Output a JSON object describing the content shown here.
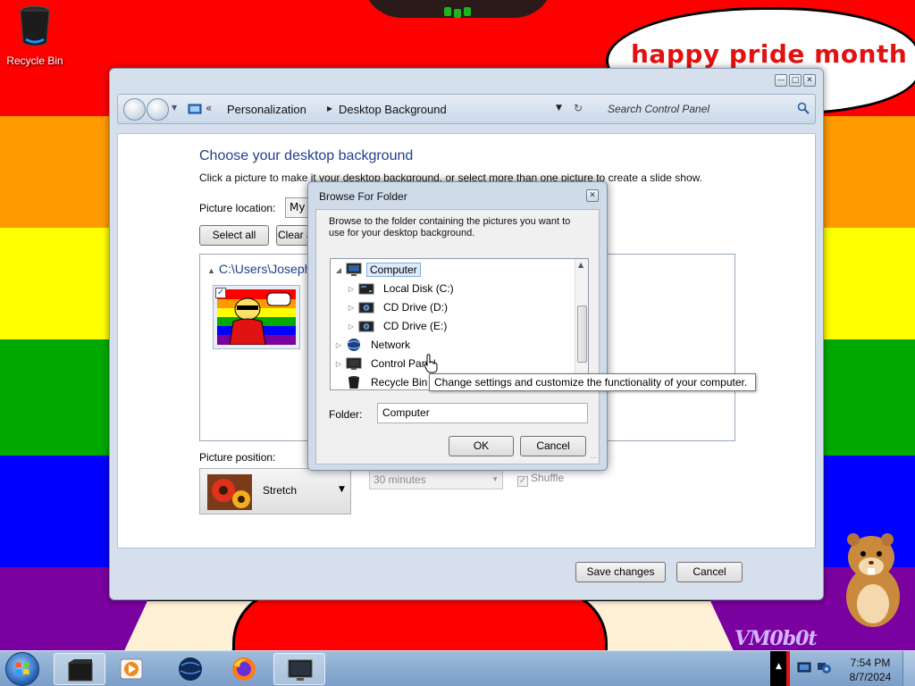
{
  "desktop": {
    "banner_text": "happy pride month",
    "watermark": "VM0b0t",
    "icons": [
      {
        "label": "Recycle Bin",
        "icon": "recycle-bin-icon"
      }
    ],
    "stripe_colors": [
      "#ff0000",
      "#ff9a00",
      "#ffff00",
      "#00a800",
      "#0000ff",
      "#7a00a0"
    ]
  },
  "window": {
    "breadcrumb": [
      "Personalization",
      "Desktop Background"
    ],
    "search_placeholder": "Search Control Panel",
    "heading": "Choose your desktop background",
    "description": "Click a picture to make it your desktop background, or select more than one picture to create a slide show.",
    "picture_location_label": "Picture location:",
    "picture_location_value": "My Pictures",
    "select_all_label": "Select all",
    "clear_all_label": "Clear all",
    "group_header": "C:\\Users\\Joseph\\Pictures",
    "picture_position_label": "Picture position:",
    "picture_position_value": "Stretch",
    "interval_value": "30 minutes",
    "shuffle_label": "Shuffle",
    "save_label": "Save changes",
    "cancel_label": "Cancel",
    "accent": "#1e3f8f"
  },
  "dialog": {
    "title": "Browse For Folder",
    "description": "Browse to the folder containing the pictures you want to use for your desktop background.",
    "tree": [
      {
        "label": "Computer",
        "icon": "computer-icon",
        "selected": true
      },
      {
        "label": "Local Disk (C:)",
        "icon": "hard-disk-icon"
      },
      {
        "label": "CD Drive (D:)",
        "icon": "cd-drive-icon"
      },
      {
        "label": "CD Drive (E:)",
        "icon": "cd-drive-icon"
      },
      {
        "label": "Network",
        "icon": "network-icon"
      },
      {
        "label": "Control Panel",
        "icon": "control-panel-icon"
      },
      {
        "label": "Recycle Bin",
        "icon": "recycle-bin-icon"
      }
    ],
    "folder_label": "Folder:",
    "folder_value": "Computer",
    "ok_label": "OK",
    "cancel_label": "Cancel",
    "tooltip": "Change settings and customize the functionality of your computer."
  },
  "taskbar": {
    "time": "7:54 PM",
    "date": "8/7/2024",
    "items": [
      {
        "name": "explorer",
        "icon": "folder-window-icon",
        "active": true
      },
      {
        "name": "media-player",
        "icon": "media-player-icon"
      },
      {
        "name": "browser",
        "icon": "globe-icon"
      },
      {
        "name": "firefox",
        "icon": "firefox-icon"
      },
      {
        "name": "control-panel",
        "icon": "monitor-icon",
        "active": true
      }
    ]
  }
}
